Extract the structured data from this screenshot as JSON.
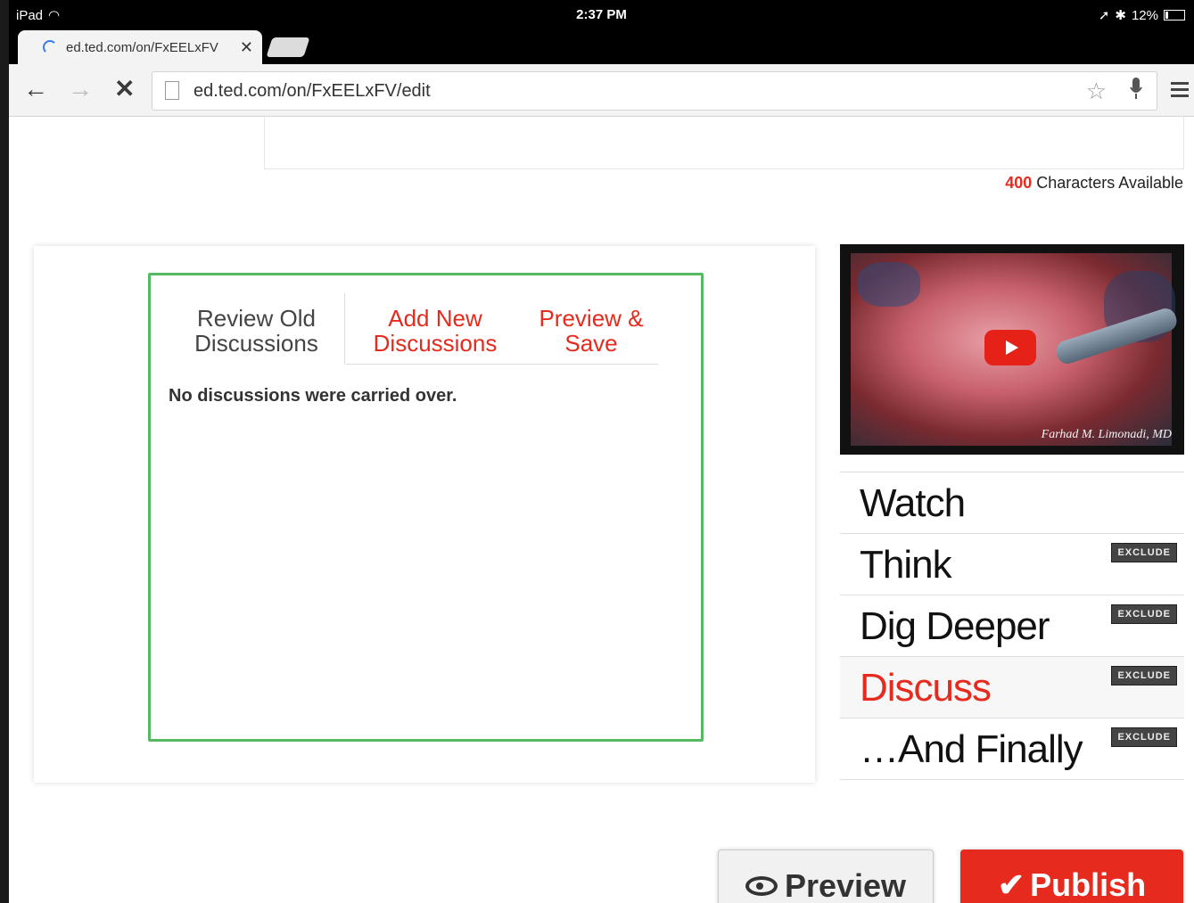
{
  "status_bar": {
    "device": "iPad",
    "time": "2:37 PM",
    "battery": "12%"
  },
  "tab": {
    "title": "ed.ted.com/on/FxEELxFV",
    "close": "✕"
  },
  "toolbar": {
    "url": "ed.ted.com/on/FxEELxFV/edit"
  },
  "chars": {
    "count": "400",
    "label": " Characters Available"
  },
  "discussion_tabs": [
    {
      "label": "Review Old Discussions"
    },
    {
      "label": "Add New Discussions"
    },
    {
      "label": "Preview & Save"
    }
  ],
  "empty_message": "No discussions were carried over.",
  "video": {
    "credit": "Farhad M. Limonadi, MD"
  },
  "steps": [
    {
      "label": "Watch"
    },
    {
      "label": "Think",
      "badge": "EXCLUDE"
    },
    {
      "label": "Dig Deeper",
      "badge": "EXCLUDE"
    },
    {
      "label": "Discuss",
      "badge": "EXCLUDE"
    },
    {
      "label": "…And Finally",
      "badge": "EXCLUDE"
    }
  ],
  "buttons": {
    "preview": "Preview",
    "publish": "Publish"
  },
  "colors": {
    "accent": "#e62b1e",
    "frame_green": "#55b863"
  }
}
